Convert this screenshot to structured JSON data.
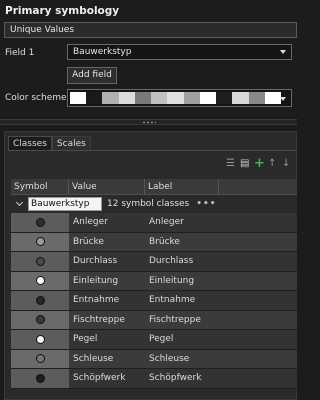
{
  "header": {
    "title": "Primary symbology"
  },
  "method": {
    "value": "Unique Values"
  },
  "field1": {
    "label": "Field 1",
    "value": "Bauwerkstyp",
    "add_button": "Add field"
  },
  "color_scheme": {
    "label": "Color scheme",
    "swatches": [
      "#ffffff",
      "#1a1a1a",
      "#b0b0b0",
      "#dcdcdc",
      "#7a7a7a",
      "#c0c0c0",
      "#e0e0e0",
      "#a0a0a0",
      "#ffffff",
      "#1e1e1e",
      "#d8d8d8",
      "#888888",
      "#ffffff"
    ]
  },
  "tabs": [
    {
      "label": "Classes"
    },
    {
      "label": "Scales"
    }
  ],
  "toolbar": {
    "icons": [
      "list-icon",
      "more-actions-icon",
      "add-icon",
      "move-up-icon",
      "move-down-icon"
    ]
  },
  "grid": {
    "headers": {
      "symbol": "Symbol",
      "value": "Value",
      "label": "Label"
    },
    "group": {
      "field": "Bauwerkstyp",
      "count": "12 symbol classes",
      "menu": "•••"
    },
    "rows": [
      {
        "value": "Anleger",
        "label": "Anleger",
        "color": "#2e2e2e"
      },
      {
        "value": "Brücke",
        "label": "Brücke",
        "color": "#9a9a9a"
      },
      {
        "value": "Durchlass",
        "label": "Durchlass",
        "color": "#4a4a4a"
      },
      {
        "value": "Einleitung",
        "label": "Einleitung",
        "color": "#ffffff"
      },
      {
        "value": "Entnahme",
        "label": "Entnahme",
        "color": "#262626"
      },
      {
        "value": "Fischtreppe",
        "label": "Fischtreppe",
        "color": "#3a3a3a"
      },
      {
        "value": "Pegel",
        "label": "Pegel",
        "color": "#f2f2f2"
      },
      {
        "value": "Schleuse",
        "label": "Schleuse",
        "color": "#777777"
      },
      {
        "value": "Schöpfwerk",
        "label": "Schöpfwerk",
        "color": "#1e1e1e"
      }
    ]
  }
}
